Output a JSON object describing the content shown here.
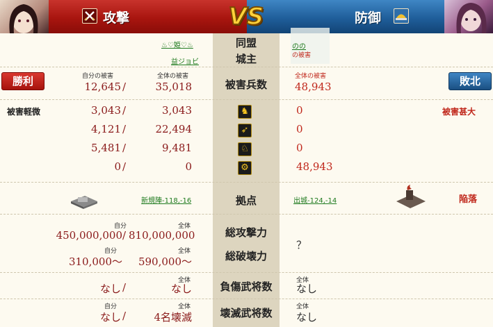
{
  "header": {
    "attacker_title": "攻撃",
    "defender_title": "防御",
    "vs_label": "VS"
  },
  "alliance": {
    "label": "同盟",
    "attacker_value": "♨♡姫♡♨",
    "defender_value": "のの"
  },
  "lord": {
    "label": "城主",
    "attacker_value": "益ジョビ",
    "defender_value": "の被害"
  },
  "damage": {
    "label": "被害兵数",
    "self_caption": "自分の被害",
    "total_caption": "全体の被害",
    "defender_caption": "全体の被害",
    "attacker_self": "12,645",
    "attacker_total": "35,018",
    "defender_total": "48,943",
    "win_label": "勝利",
    "lose_label": "敗北"
  },
  "reduction": {
    "attacker_label": "被害軽微",
    "defender_label": "被害甚大"
  },
  "unit_rows": [
    {
      "icon": "spear-soldier-icon",
      "glyph": "♞",
      "self": "3,043",
      "total": "3,043",
      "defender": "0"
    },
    {
      "icon": "bow-icon",
      "glyph": "➶",
      "self": "4,121",
      "total": "22,494",
      "defender": "0"
    },
    {
      "icon": "horse-icon",
      "glyph": "♘",
      "self": "5,481",
      "total": "9,481",
      "defender": "0"
    },
    {
      "icon": "siege-icon",
      "glyph": "⚙",
      "self": "0",
      "total": "0",
      "defender": "48,943"
    }
  ],
  "base": {
    "label": "拠点",
    "attacker_link": "新規陣-118,-16",
    "defender_link": "出城-124,-14",
    "defender_status": "陥落"
  },
  "attack_power": {
    "label": "総攻撃力",
    "self_caption": "自分",
    "total_caption": "全体",
    "attacker_self": "450,000,000",
    "attacker_total": "810,000,000",
    "defender_value": "？"
  },
  "destroy_power": {
    "label": "総破壊力",
    "self_caption": "自分",
    "total_caption": "全体",
    "attacker_self": "310,000～",
    "attacker_total": "590,000～"
  },
  "injured": {
    "label": "負傷武将数",
    "total_caption": "全体",
    "defender_caption": "全体",
    "attacker_self": "なし",
    "attacker_total": "なし",
    "defender_value": "なし"
  },
  "destroyed": {
    "label": "壊滅武将数",
    "self_caption": "自分",
    "total_caption": "全体",
    "defender_caption": "全体",
    "attacker_self": "なし",
    "attacker_total": "4名壊滅",
    "defender_value": "なし"
  },
  "separator": "/"
}
